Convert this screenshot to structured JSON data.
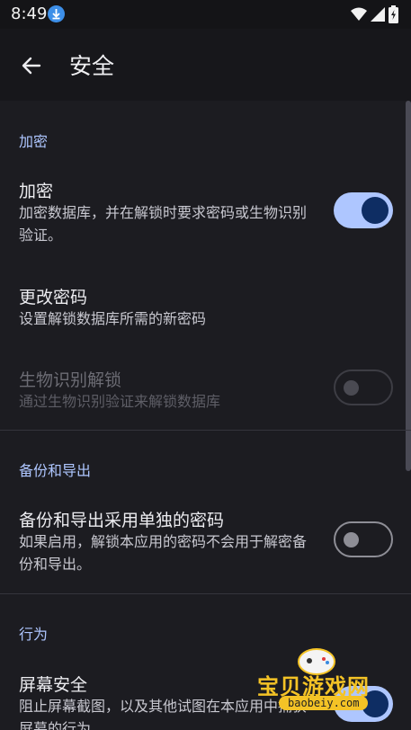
{
  "status_bar": {
    "time": "8:49"
  },
  "app_bar": {
    "title": "安全"
  },
  "sections": {
    "encryption": {
      "header": "加密"
    },
    "backup": {
      "header": "备份和导出"
    },
    "behavior": {
      "header": "行为"
    }
  },
  "prefs": {
    "encrypt": {
      "title": "加密",
      "summary": "加密数据库，并在解锁时要求密码或生物识别验证。",
      "enabled": true
    },
    "change_password": {
      "title": "更改密码",
      "summary": "设置解锁数据库所需的新密码"
    },
    "biometric_unlock": {
      "title": "生物识别解锁",
      "summary": "通过生物识别验证来解锁数据库",
      "enabled": false,
      "disabled": true
    },
    "backup_password": {
      "title": "备份和导出采用单独的密码",
      "summary": "如果启用，解锁本应用的密码不会用于解密备份和导出。",
      "enabled": false
    },
    "screen_security": {
      "title": "屏幕安全",
      "summary": "阻止屏幕截图，以及其他试图在本应用中捕获屏幕的行为",
      "enabled": true
    }
  },
  "watermark": {
    "text": "宝贝游戏网",
    "url": "baobeiy.com"
  },
  "colors": {
    "accent": "#aec6ff",
    "switch_knob_on": "#0e2d63",
    "background": "#1c1c21"
  }
}
